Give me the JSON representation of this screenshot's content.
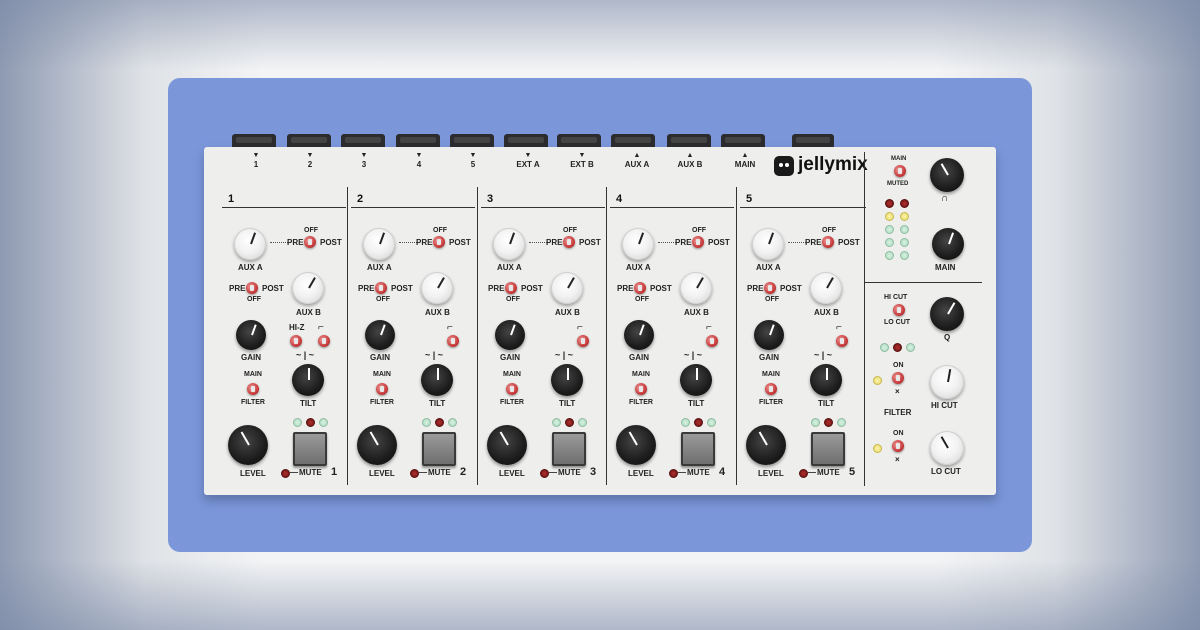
{
  "brand": {
    "name": "jellymix"
  },
  "top_outputs": [
    {
      "label": "1",
      "dir": "▼"
    },
    {
      "label": "2",
      "dir": "▼"
    },
    {
      "label": "3",
      "dir": "▼"
    },
    {
      "label": "4",
      "dir": "▼"
    },
    {
      "label": "5",
      "dir": "▼"
    },
    {
      "label": "EXT A",
      "dir": "▼"
    },
    {
      "label": "EXT B",
      "dir": "▼"
    },
    {
      "label": "AUX A",
      "dir": "▲"
    },
    {
      "label": "AUX B",
      "dir": "▲"
    },
    {
      "label": "MAIN",
      "dir": "▲"
    }
  ],
  "channels": [
    {
      "number": "1",
      "hiz": "HI-Z",
      "footer_number": "1"
    },
    {
      "number": "2",
      "hiz": "",
      "footer_number": "2"
    },
    {
      "number": "3",
      "hiz": "",
      "footer_number": "3"
    },
    {
      "number": "4",
      "hiz": "",
      "footer_number": "4"
    },
    {
      "number": "5",
      "hiz": "",
      "footer_number": "5"
    }
  ],
  "channel_labels": {
    "aux_a": "AUX A",
    "aux_b": "AUX B",
    "pre": "PRE",
    "post": "POST",
    "off": "OFF",
    "gain": "GAIN",
    "tilt": "TILT",
    "main": "MAIN",
    "filter": "FILTER",
    "level": "LEVEL",
    "mute": "MUTE"
  },
  "master": {
    "main_switch_top": "MAIN",
    "main_switch_bottom": "MUTED",
    "headphone_icon": "headphone-icon",
    "main_knob": "MAIN",
    "hi_cut_sw": "HI CUT",
    "lo_cut_sw": "LO CUT",
    "q": "Q",
    "on": "ON",
    "off_mark": "×",
    "filter": "FILTER",
    "hi_cut": "HI CUT",
    "lo_cut": "LO CUT"
  },
  "colors": {
    "card": "#7b97da",
    "panel": "#eeeeec",
    "switch": "#c83a3a"
  }
}
